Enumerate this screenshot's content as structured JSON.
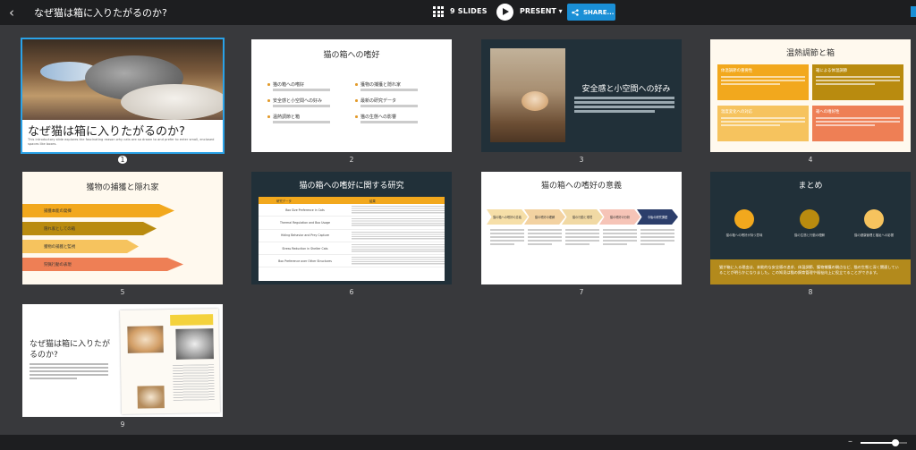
{
  "header": {
    "title": "なぜ猫は箱に入りたがるのか?",
    "slides_count": "9 SLIDES",
    "present_label": "PRESENT ▾",
    "share_label": "SHARE..."
  },
  "slides": [
    {
      "number": "1",
      "title": "なぜ猫は箱に入りたがるのか?",
      "desc": "This introductory slide explores the fascinating reason why cats are so drawn to and prefer to enter small, enclosed spaces like boxes."
    },
    {
      "number": "2",
      "title": "猫の箱への嗜好",
      "items": [
        "猫の箱への嗜好",
        "獲物の捕獲と隠れ家",
        "安全感と小空間への好み",
        "最新の研究データ",
        "温熱調節と箱",
        "猫の生態への影響"
      ]
    },
    {
      "number": "3",
      "title": "安全感と小空間への好み"
    },
    {
      "number": "4",
      "title": "温熱調節と箱",
      "boxes": [
        "体温調節の重要性",
        "箱による体温調節",
        "温度変化への対応",
        "箱への嗜好性"
      ]
    },
    {
      "number": "5",
      "title": "獲物の捕獲と隠れ家",
      "arrows": [
        "捕獲本能の発揮",
        "隠れ家としての箱",
        "獲物の捕獲と監視",
        "狩猟行動の表現"
      ]
    },
    {
      "number": "6",
      "title": "猫の箱への嗜好に関する研究",
      "table_head": [
        "研究データ",
        "結果"
      ],
      "rows": [
        "Box Size Preference in Cats",
        "Thermal Regulation and Box Usage",
        "Hiding Behavior and Prey Capture",
        "Stress Reduction in Shelter Cats",
        "Box Preference over Other Structures"
      ]
    },
    {
      "number": "7",
      "title": "猫の箱への嗜好の意義",
      "steps": [
        "猫の箱への嗜好の意義",
        "猫の嗜好の理解",
        "猫の行動と環境",
        "猫の嗜好の分析",
        "今後の研究課題"
      ]
    },
    {
      "number": "8",
      "title": "まとめ",
      "points": [
        "猫の箱への嗜好が持つ意味",
        "猫の生態と行動の理解",
        "猫の健康管理と福祉への影響"
      ],
      "summary": "猫が箱に入る理由は、本能的な安全感の追求、体温調節、獲物捕獲の観点など、猫の生態と深く関連していることが明らかになりました。この知見は猫の飼育管理や福祉向上に役立てることができます。"
    },
    {
      "number": "9",
      "title": "なぜ猫は箱に入りたがるのか?"
    }
  ],
  "colors": {
    "topbar": "#1d1e20",
    "background": "#38393c",
    "accent_blue": "#1a8fd6",
    "orange": "#f2a81d",
    "dark_teal": "#213039"
  },
  "zoom_level": 0.75
}
